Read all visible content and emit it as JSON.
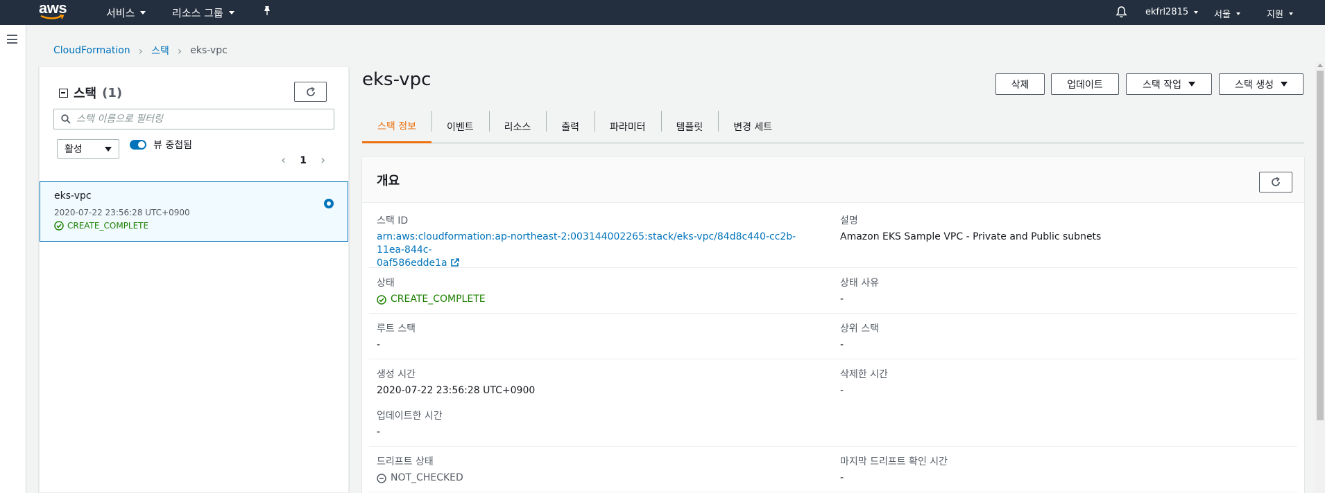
{
  "topnav": {
    "logo": "aws",
    "services": "서비스",
    "resource_groups": "리소스 그룹",
    "pin_icon": "pin-icon",
    "bell_icon": "bell-icon",
    "account": "ekfrl2815",
    "region": "서울",
    "support": "지원"
  },
  "breadcrumb": {
    "items": [
      "CloudFormation",
      "스택",
      "eks-vpc"
    ]
  },
  "stack_list": {
    "title": "스택",
    "count": "(1)",
    "search_placeholder": "스택 이름으로 필터링",
    "filter_value": "활성",
    "toggle_label": "뷰 중첩됨",
    "page": "1",
    "stacks": [
      {
        "name": "eks-vpc",
        "created": "2020-07-22 23:56:28 UTC+0900",
        "status": "CREATE_COMPLETE"
      }
    ]
  },
  "main": {
    "title": "eks-vpc",
    "actions": {
      "delete": "삭제",
      "update": "업데이트",
      "stack_actions": "스택 작업",
      "create_stack": "스택 생성"
    },
    "tabs": [
      "스택 정보",
      "이벤트",
      "리소스",
      "출력",
      "파라미터",
      "템플릿",
      "변경 세트"
    ],
    "overview": {
      "title": "개요",
      "stack_id_label": "스택 ID",
      "stack_id_line1": "arn:aws:cloudformation:ap-northeast-2:003144002265:stack/eks-vpc/84d8c440-cc2b-11ea-844c-",
      "stack_id_line2": "0af586edde1a",
      "description_label": "설명",
      "description": "Amazon EKS Sample VPC - Private and Public subnets",
      "status_label": "상태",
      "status": "CREATE_COMPLETE",
      "status_reason_label": "상태 사유",
      "status_reason": "-",
      "root_stack_label": "루트 스택",
      "root_stack": "-",
      "parent_stack_label": "상위 스택",
      "parent_stack": "-",
      "created_label": "생성 시간",
      "created": "2020-07-22 23:56:28 UTC+0900",
      "deleted_label": "삭제한 시간",
      "deleted": "-",
      "updated_label": "업데이트한 시간",
      "updated": "-",
      "drift_label": "드리프트 상태",
      "drift": "NOT_CHECKED",
      "last_drift_label": "마지막 드리프트 확인 시간",
      "last_drift": "-"
    }
  },
  "colors": {
    "nav_bg": "#232f3e",
    "link": "#0073bb",
    "success": "#1d8102",
    "active_tab": "#ec7211"
  }
}
